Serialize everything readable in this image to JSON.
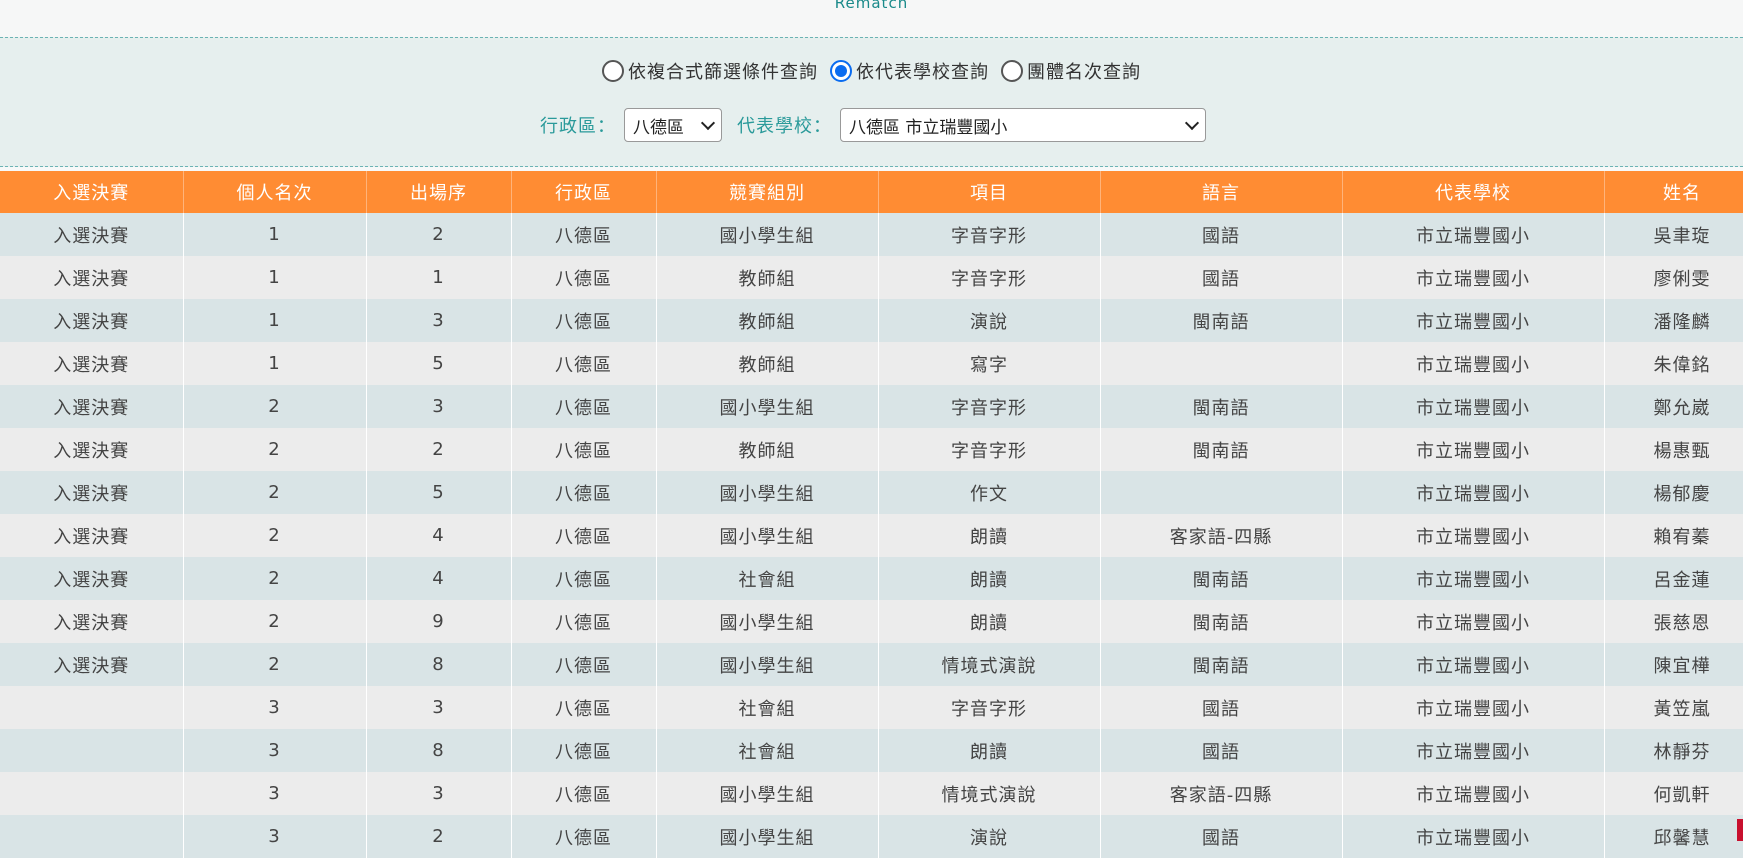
{
  "header": {
    "rematch_label": "Rematch"
  },
  "query_modes": [
    {
      "label": "依複合式篩選條件查詢",
      "selected": false
    },
    {
      "label": "依代表學校查詢",
      "selected": true
    },
    {
      "label": "團體名次查詢",
      "selected": false
    }
  ],
  "filters": {
    "district_label": "行政區：",
    "district_value": "八德區",
    "school_label": "代表學校：",
    "school_value": "八德區 市立瑞豐國小"
  },
  "table": {
    "columns": [
      "入選決賽",
      "個人名次",
      "出場序",
      "行政區",
      "競賽組別",
      "項目",
      "語言",
      "代表學校",
      "姓名"
    ],
    "rows": [
      [
        "入選決賽",
        "1",
        "2",
        "八德區",
        "國小學生組",
        "字音字形",
        "國語",
        "市立瑞豐國小",
        "吳聿琁"
      ],
      [
        "入選決賽",
        "1",
        "1",
        "八德區",
        "教師組",
        "字音字形",
        "國語",
        "市立瑞豐國小",
        "廖俐雯"
      ],
      [
        "入選決賽",
        "1",
        "3",
        "八德區",
        "教師組",
        "演說",
        "閩南語",
        "市立瑞豐國小",
        "潘隆麟"
      ],
      [
        "入選決賽",
        "1",
        "5",
        "八德區",
        "教師組",
        "寫字",
        "",
        "市立瑞豐國小",
        "朱偉銘"
      ],
      [
        "入選決賽",
        "2",
        "3",
        "八德區",
        "國小學生組",
        "字音字形",
        "閩南語",
        "市立瑞豐國小",
        "鄭允崴"
      ],
      [
        "入選決賽",
        "2",
        "2",
        "八德區",
        "教師組",
        "字音字形",
        "閩南語",
        "市立瑞豐國小",
        "楊惠甄"
      ],
      [
        "入選決賽",
        "2",
        "5",
        "八德區",
        "國小學生組",
        "作文",
        "",
        "市立瑞豐國小",
        "楊郁慶"
      ],
      [
        "入選決賽",
        "2",
        "4",
        "八德區",
        "國小學生組",
        "朗讀",
        "客家語-四縣",
        "市立瑞豐國小",
        "賴宥蓁"
      ],
      [
        "入選決賽",
        "2",
        "4",
        "八德區",
        "社會組",
        "朗讀",
        "閩南語",
        "市立瑞豐國小",
        "呂金蓮"
      ],
      [
        "入選決賽",
        "2",
        "9",
        "八德區",
        "國小學生組",
        "朗讀",
        "閩南語",
        "市立瑞豐國小",
        "張慈恩"
      ],
      [
        "入選決賽",
        "2",
        "8",
        "八德區",
        "國小學生組",
        "情境式演說",
        "閩南語",
        "市立瑞豐國小",
        "陳宜樺"
      ],
      [
        "",
        "3",
        "3",
        "八德區",
        "社會組",
        "字音字形",
        "國語",
        "市立瑞豐國小",
        "黃笠嵐"
      ],
      [
        "",
        "3",
        "8",
        "八德區",
        "社會組",
        "朗讀",
        "國語",
        "市立瑞豐國小",
        "林靜芬"
      ],
      [
        "",
        "3",
        "3",
        "八德區",
        "國小學生組",
        "情境式演說",
        "客家語-四縣",
        "市立瑞豐國小",
        "何凱軒"
      ],
      [
        "",
        "3",
        "2",
        "八德區",
        "國小學生組",
        "演說",
        "國語",
        "市立瑞豐國小",
        "邱馨慧"
      ]
    ]
  }
}
